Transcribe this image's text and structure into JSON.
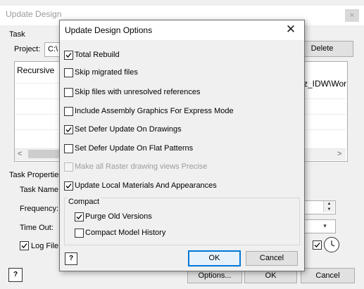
{
  "background_window": {
    "title": "Update Design",
    "close_glyph": "×",
    "task_label": "Task",
    "project_label": "Project:",
    "project_value": "C:\\",
    "delete_label": "Delete",
    "list_first": "Recursive",
    "list_right": "rz_IDW\\Wor",
    "scroll_left": "<",
    "scroll_right": ">",
    "task_properties_label": "Task Properties",
    "task_name_label": "Task Name:",
    "frequency_label": "Frequency:",
    "time_out_label": "Time Out:",
    "log_file_label": "Log File:",
    "log_file_checked": true,
    "spin_up": "▲",
    "spin_down": "▼",
    "combo_arrow": "▾",
    "help_label": "?",
    "options_label": "Options...",
    "ok_label": "OK",
    "cancel_label": "Cancel"
  },
  "dialog": {
    "title": "Update Design Options",
    "close_glyph": "✕",
    "options": [
      {
        "label": "Total Rebuild",
        "checked": true,
        "disabled": false
      },
      {
        "label": "Skip migrated files",
        "checked": false,
        "disabled": false
      },
      {
        "label": "Skip files with unresolved references",
        "checked": false,
        "disabled": false
      },
      {
        "label": "Include Assembly Graphics For Express Mode",
        "checked": false,
        "disabled": false
      },
      {
        "label": "Set Defer Update On Drawings",
        "checked": true,
        "disabled": false
      },
      {
        "label": "Set Defer Update On Flat Patterns",
        "checked": false,
        "disabled": false
      },
      {
        "label": "Make all Raster drawing views Precise",
        "checked": false,
        "disabled": true
      },
      {
        "label": "Update Local Materials And Appearances",
        "checked": true,
        "disabled": false
      }
    ],
    "compact": {
      "label": "Compact",
      "options": [
        {
          "label": "Purge Old Versions",
          "checked": true
        },
        {
          "label": "Compact Model History",
          "checked": false
        }
      ]
    },
    "help_label": "?",
    "ok_label": "OK",
    "cancel_label": "Cancel"
  },
  "colors": {
    "accent": "#0078d7",
    "window_bg": "#f0f0f0",
    "disabled_text": "#9d9d9d"
  }
}
